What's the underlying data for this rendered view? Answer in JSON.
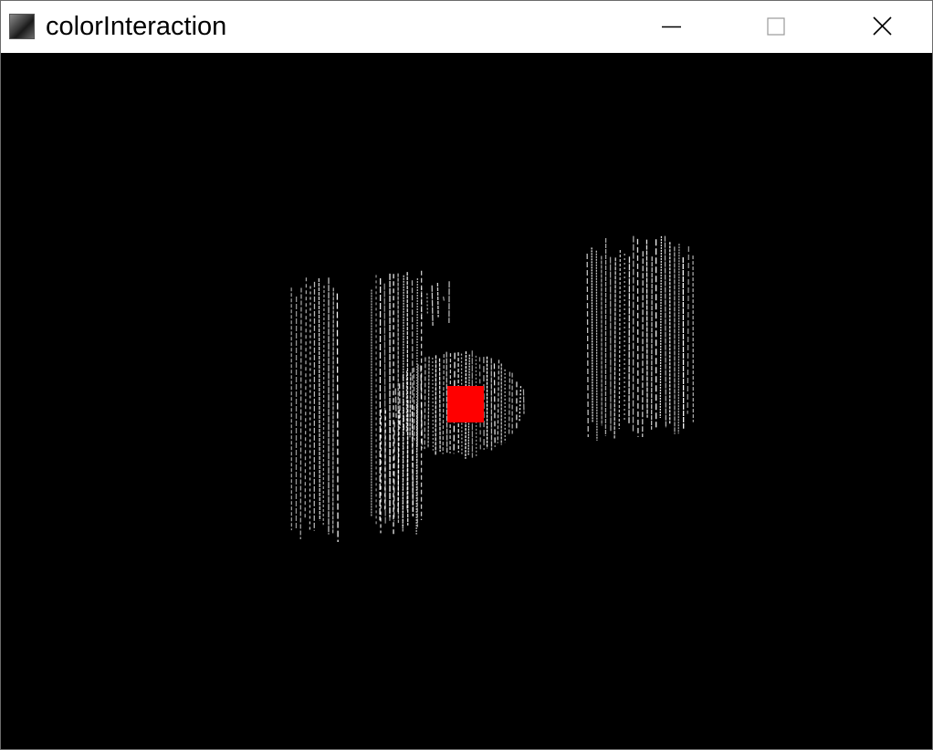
{
  "window": {
    "title": "colorInteraction",
    "icon": "app-icon"
  },
  "controls": {
    "minimize_icon": "minimize-icon",
    "maximize_icon": "maximize-icon",
    "close_icon": "close-icon"
  },
  "canvas": {
    "background": "#000000",
    "point_color": "#ffffff",
    "marker_color": "#ff0000"
  }
}
